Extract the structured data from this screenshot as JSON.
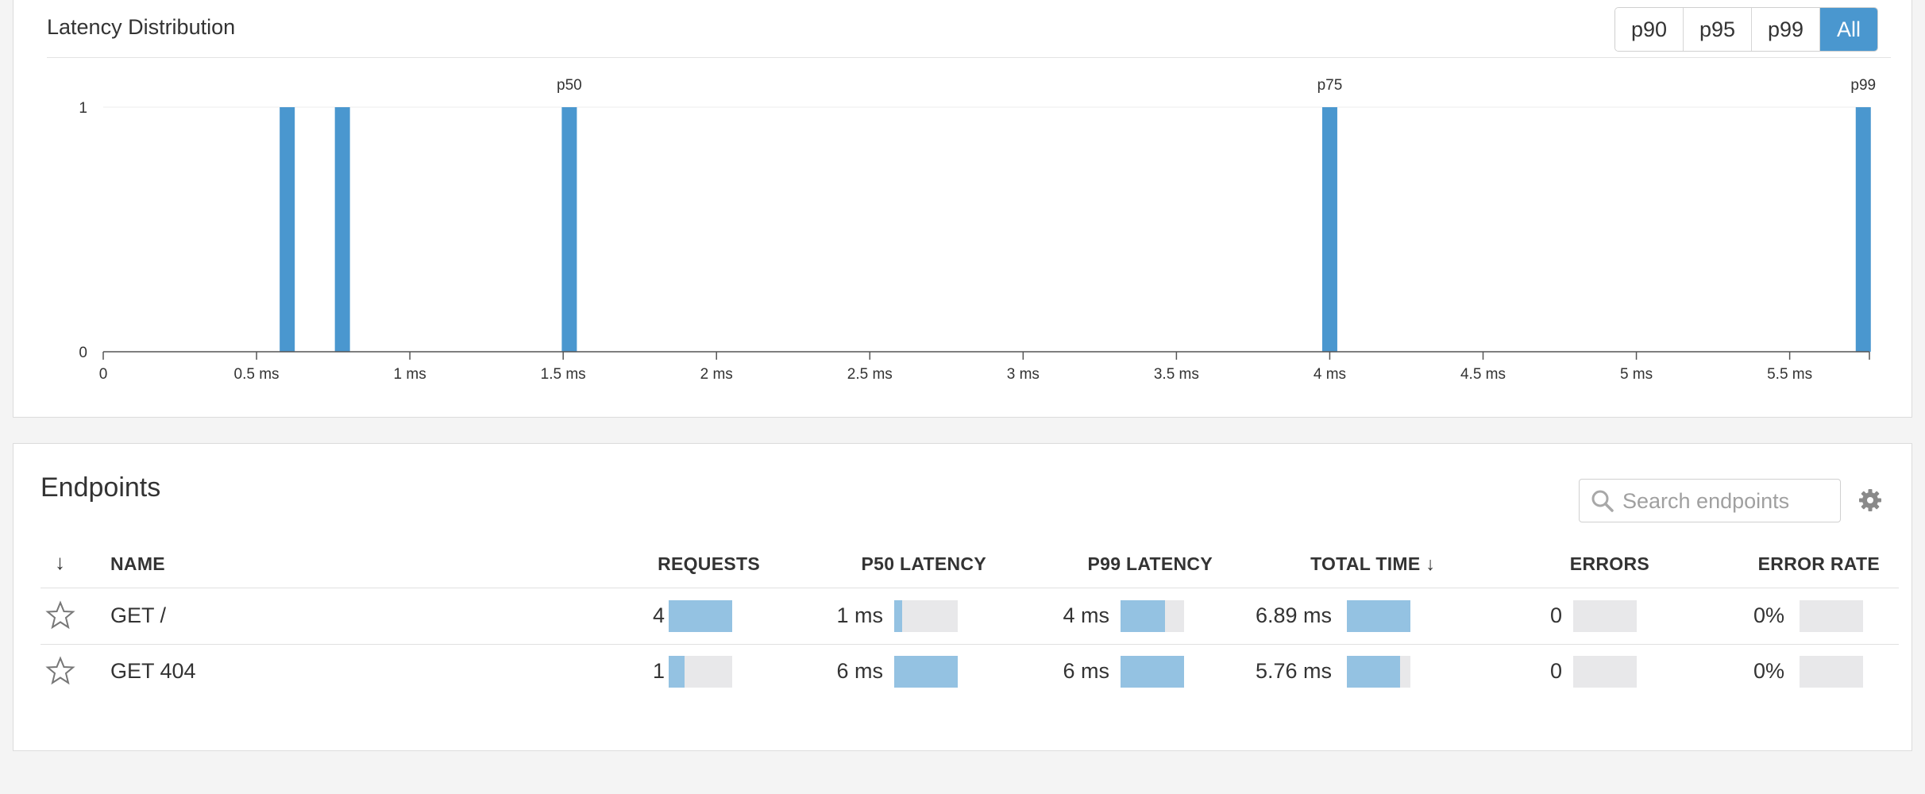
{
  "latency_panel": {
    "title": "Latency Distribution",
    "percentile_buttons": [
      {
        "label": "p90",
        "active": false
      },
      {
        "label": "p95",
        "active": false
      },
      {
        "label": "p99",
        "active": false
      },
      {
        "label": "All",
        "active": true
      }
    ]
  },
  "chart_data": {
    "type": "bar",
    "title": "",
    "xlabel": "",
    "ylabel": "",
    "x_unit": "ms",
    "xlim": [
      0,
      5.76
    ],
    "ylim": [
      0,
      1
    ],
    "x_ticks": [
      0,
      0.5,
      1,
      1.5,
      2,
      2.5,
      3,
      3.5,
      4,
      4.5,
      5,
      5.5
    ],
    "x_tick_labels": [
      "0",
      "0.5 ms",
      "1 ms",
      "1.5 ms",
      "2 ms",
      "2.5 ms",
      "3 ms",
      "3.5 ms",
      "4 ms",
      "4.5 ms",
      "5 ms",
      "5.5 ms"
    ],
    "y_ticks": [
      0,
      1
    ],
    "y_tick_labels": [
      "0",
      "1"
    ],
    "bars": [
      {
        "x": 0.6,
        "count": 1
      },
      {
        "x": 0.78,
        "count": 1
      },
      {
        "x": 1.52,
        "count": 1
      },
      {
        "x": 4.0,
        "count": 1
      },
      {
        "x": 5.74,
        "count": 1
      }
    ],
    "markers": [
      {
        "label": "p50",
        "x": 1.52
      },
      {
        "label": "p75",
        "x": 4.0
      },
      {
        "label": "p99",
        "x": 5.74
      }
    ],
    "bar_color": "#4a97cf",
    "grid": false,
    "legend": "none"
  },
  "endpoints_panel": {
    "title": "Endpoints",
    "search_placeholder": "Search endpoints",
    "sort_indicator": "↓",
    "columns": {
      "name": "NAME",
      "requests": "REQUESTS",
      "p50": "P50 LATENCY",
      "p99": "P99 LATENCY",
      "total": "TOTAL TIME ↓",
      "errors": "ERRORS",
      "error_rate": "ERROR RATE"
    },
    "rows": [
      {
        "name": "GET /",
        "requests": "4",
        "requests_frac": 1.0,
        "p50": "1 ms",
        "p50_frac": 0.12,
        "p99": "4 ms",
        "p99_frac": 0.7,
        "total": "6.89 ms",
        "total_frac": 1.0,
        "errors": "0",
        "errors_frac": 0,
        "error_rate": "0%",
        "error_rate_frac": 0
      },
      {
        "name": "GET 404",
        "requests": "1",
        "requests_frac": 0.25,
        "p50": "6 ms",
        "p50_frac": 1.0,
        "p99": "6 ms",
        "p99_frac": 1.0,
        "total": "5.76 ms",
        "total_frac": 0.84,
        "errors": "0",
        "errors_frac": 0,
        "error_rate": "0%",
        "error_rate_frac": 0
      }
    ]
  },
  "colors": {
    "accent": "#4a97cf",
    "bar_fill": "#94c2e2",
    "bar_track": "#e8e8ea"
  }
}
